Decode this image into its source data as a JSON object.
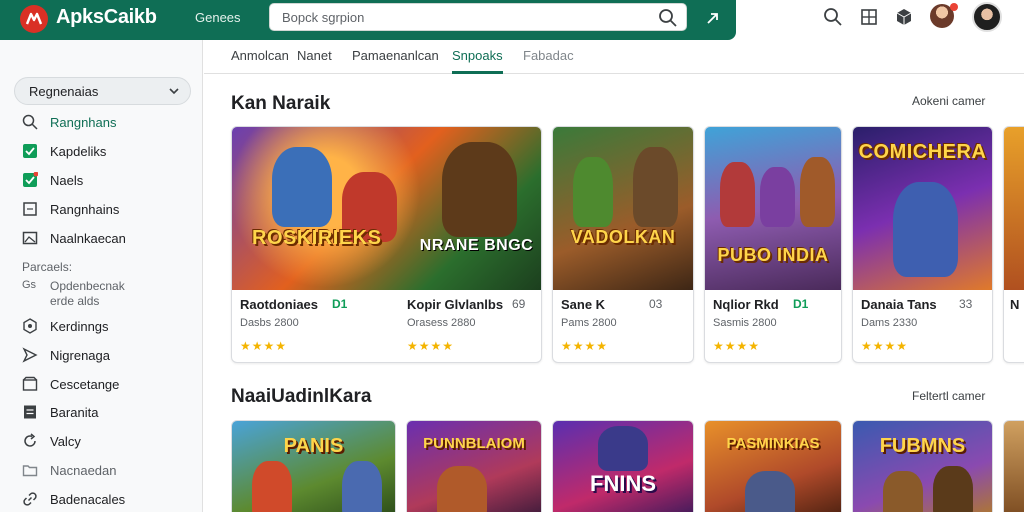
{
  "app": {
    "brand": "ApksCaikb",
    "header_link": "Genees",
    "search_placeholder": "Bopck sgrpion"
  },
  "header_icons": [
    "search-icon",
    "grid-icon",
    "cube-icon",
    "avatar",
    "profile-avatar"
  ],
  "sidebar": {
    "select_label": "Regnenaias",
    "items": [
      {
        "label": "Rangnhans",
        "icon": "search-icon",
        "active": true
      },
      {
        "label": "Kapdeliks",
        "icon": "check-box-icon"
      },
      {
        "label": "Naels",
        "icon": "check-box-icon"
      },
      {
        "label": "Rangnhains",
        "icon": "square-icon"
      },
      {
        "label": "Naalnkaecan",
        "icon": "image-icon"
      }
    ],
    "section_label": "Parcaels:",
    "section_lines": [
      "Opdenbecnak",
      "erde alds"
    ],
    "section_prefix": "Gs",
    "items2": [
      {
        "label": "Kerdinngs",
        "icon": "settings-icon"
      },
      {
        "label": "Nigrenaga",
        "icon": "send-icon"
      },
      {
        "label": "Cescetange",
        "icon": "box-icon"
      },
      {
        "label": "Baranita",
        "icon": "doc-icon"
      },
      {
        "label": "Valcy",
        "icon": "refresh-icon"
      },
      {
        "label": "Nacnaedan",
        "icon": "folder-icon"
      },
      {
        "label": "Badenacales",
        "icon": "link-icon"
      }
    ]
  },
  "tabs": [
    {
      "label": "Anmolcan",
      "state": "normal"
    },
    {
      "label": "Nanet",
      "state": "normal"
    },
    {
      "label": "Pamaenanlcan",
      "state": "normal"
    },
    {
      "label": "Snpoaks",
      "state": "active"
    },
    {
      "label": "Fabadac",
      "state": "muted"
    }
  ],
  "section1": {
    "title": "Kan Naraik",
    "more": "Aokeni camer",
    "cards": [
      {
        "art": "ROSKIRIEKS",
        "name": "Raotdoniaes",
        "badge": "D1",
        "num": "",
        "sub": "Dasbs 2800",
        "stars": "★★★★"
      },
      {
        "art": "NRANE BNGC",
        "name": "Kopir Glvlanlbs",
        "badge": "",
        "num": "69",
        "sub": "Orasess 2880",
        "stars": "★★★★"
      },
      {
        "art": "VADOLKAN",
        "name": "Sane K",
        "badge": "",
        "num": "03",
        "sub": "Pams 2800",
        "stars": "★★★★"
      },
      {
        "art": "PUBO INDIA",
        "name": "Nqlior Rkd",
        "badge": "D1",
        "num": "",
        "sub": "Sasmis 2800",
        "stars": "★★★★"
      },
      {
        "art": "COMICHERA",
        "name": "Danaia Tans",
        "badge": "",
        "num": "33",
        "sub": "Dams 2330",
        "stars": "★★★★"
      },
      {
        "art": "",
        "name": "N",
        "badge": "",
        "num": "",
        "sub": "",
        "stars": ""
      }
    ]
  },
  "section2": {
    "title": "NaaiUadinlKara",
    "more": "Feltertl camer",
    "cards": [
      {
        "art": "PANIS"
      },
      {
        "art": "PUNNBLAIOM"
      },
      {
        "art": "FNINS"
      },
      {
        "art": "PASMINKIAS"
      },
      {
        "art": "FUBMNS"
      },
      {
        "art": ""
      }
    ]
  },
  "colors": {
    "primary": "#0f6e55",
    "star": "#f4b400",
    "badge": "#0f9d58"
  }
}
